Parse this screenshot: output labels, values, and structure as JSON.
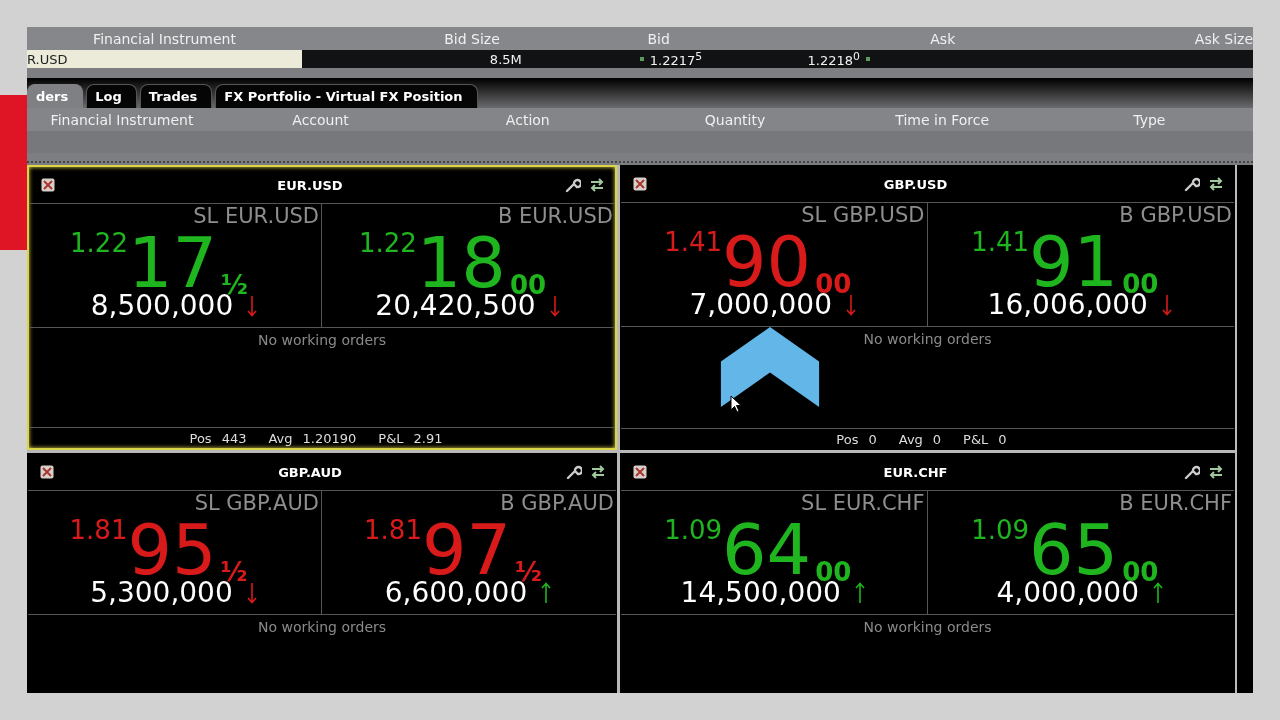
{
  "quote_panel": {
    "columns": [
      "Financial Instrument",
      "Bid Size",
      "Bid",
      "Ask",
      "Ask Size"
    ],
    "row": {
      "instrument": "R.USD",
      "bid_size": "8.5M",
      "bid": "1.2217$^{5}$",
      "ask": "1.2218$^{0}$"
    }
  },
  "tabs": [
    {
      "label": "ders",
      "selected": true
    },
    {
      "label": "Log",
      "selected": false
    },
    {
      "label": "Trades",
      "selected": false
    },
    {
      "label": "FX Portfolio - Virtual FX Position",
      "selected": false
    }
  ],
  "order_columns": [
    "Financial Instrument",
    "Account",
    "Action",
    "Quantity",
    "Time in Force",
    "Type"
  ],
  "tiles": [
    {
      "title": "EUR.USD",
      "selected": true,
      "sides": [
        {
          "label": "SL EUR.USD",
          "price_up": true,
          "handle": "1.22",
          "pips": "17",
          "fraction": "½",
          "size": "8,500,000",
          "size_up": false
        },
        {
          "label": "B EUR.USD",
          "price_up": true,
          "handle": "1.22",
          "pips": "18",
          "fraction": "00",
          "size": "20,420,500",
          "size_up": false
        }
      ],
      "status": "No working orders",
      "footer": [
        {
          "label": "Pos",
          "value": "443"
        },
        {
          "label": "Avg",
          "value": "1.20190"
        },
        {
          "label": "P&L",
          "value": "2.91"
        }
      ]
    },
    {
      "title": "GBP.USD",
      "selected": false,
      "sides": [
        {
          "label": "SL GBP.USD",
          "price_up": false,
          "handle": "1.41",
          "pips": "90",
          "fraction": "00",
          "size": "7,000,000",
          "size_up": false
        },
        {
          "label": "B GBP.USD",
          "price_up": true,
          "handle": "1.41",
          "pips": "91",
          "fraction": "00",
          "size": "16,006,000",
          "size_up": false
        }
      ],
      "status": "No working orders",
      "footer": [
        {
          "label": "Pos",
          "value": "0"
        },
        {
          "label": "Avg",
          "value": "0"
        },
        {
          "label": "P&L",
          "value": "0"
        }
      ]
    },
    {
      "title": "GBP.AUD",
      "selected": false,
      "sides": [
        {
          "label": "SL GBP.AUD",
          "price_up": false,
          "handle": "1.81",
          "pips": "95",
          "fraction": "½",
          "size": "5,300,000",
          "size_up": false
        },
        {
          "label": "B GBP.AUD",
          "price_up": false,
          "handle": "1.81",
          "pips": "97",
          "fraction": "½",
          "size": "6,600,000",
          "size_up": true
        }
      ],
      "status": "No working orders"
    },
    {
      "title": "EUR.CHF",
      "selected": false,
      "sides": [
        {
          "label": "SL EUR.CHF",
          "price_up": true,
          "handle": "1.09",
          "pips": "64",
          "fraction": "00",
          "size": "14,500,000",
          "size_up": true
        },
        {
          "label": "B EUR.CHF",
          "price_up": true,
          "handle": "1.09",
          "pips": "65",
          "fraction": "00",
          "size": "4,000,000",
          "size_up": true
        }
      ],
      "status": "No working orders"
    }
  ]
}
